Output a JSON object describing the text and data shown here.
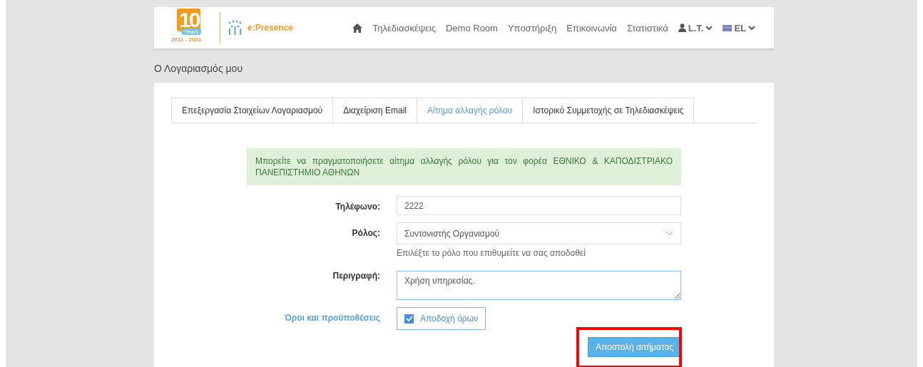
{
  "logo": {
    "number": "10",
    "badge": "Years",
    "years": "2011 - 2021",
    "brand": "e:Presence"
  },
  "nav": [
    {
      "kind": "home"
    },
    {
      "kind": "link",
      "label": "Τηλεδιασκέψεις"
    },
    {
      "kind": "link",
      "label": "Demo Room"
    },
    {
      "kind": "link",
      "label": "Υποστήριξη"
    },
    {
      "kind": "link",
      "label": "Επικοινωνία"
    },
    {
      "kind": "link",
      "label": "Στατιστικά"
    },
    {
      "kind": "user",
      "label": "L.T."
    },
    {
      "kind": "language",
      "label": "EL"
    }
  ],
  "page_title": "Ο Λογαριασμός μου",
  "tabs": [
    {
      "label": "Επεξεργασία Στοιχείων Λογαριασμού",
      "selected": false
    },
    {
      "label": "Διαχείριση Email",
      "selected": false
    },
    {
      "label": "Αίτημα αλλαγής ρόλου",
      "selected": true
    },
    {
      "label": "Ιστορικό Συμμετοχής σε Τηλεδιασκέψεις",
      "selected": false
    }
  ],
  "alert": "Μπορείτε να πραγματοποιήσετε αίτημα αλλαγής ρόλου για τον φορέα ΕΘΝΙΚΟ & ΚΑΠΟΔΙΣΤΡΙΑΚΟ ΠΑΝΕΠΙΣΤΗΜΙΟ ΑΘΗΝΩΝ",
  "form": [
    {
      "kind": "text",
      "label": "Τηλέφωνο:",
      "value": "2222"
    },
    {
      "kind": "select",
      "label": "Ρόλος:",
      "value": "Συντονιστής Οργανισμού",
      "help": "Επιλέξτε το ρόλο που επιθυμείτε να σας αποδοθεί"
    },
    {
      "kind": "textarea",
      "label": "Περιγραφή:",
      "value": "Χρήση υπηρεσίας."
    }
  ],
  "terms": {
    "link": "Όροι και προϋποθέσεις",
    "checkbox_label": "Αποδοχή όρων",
    "checked": true
  },
  "submit": {
    "label": "Αποστολή αιτήματος",
    "highlighted": true
  }
}
